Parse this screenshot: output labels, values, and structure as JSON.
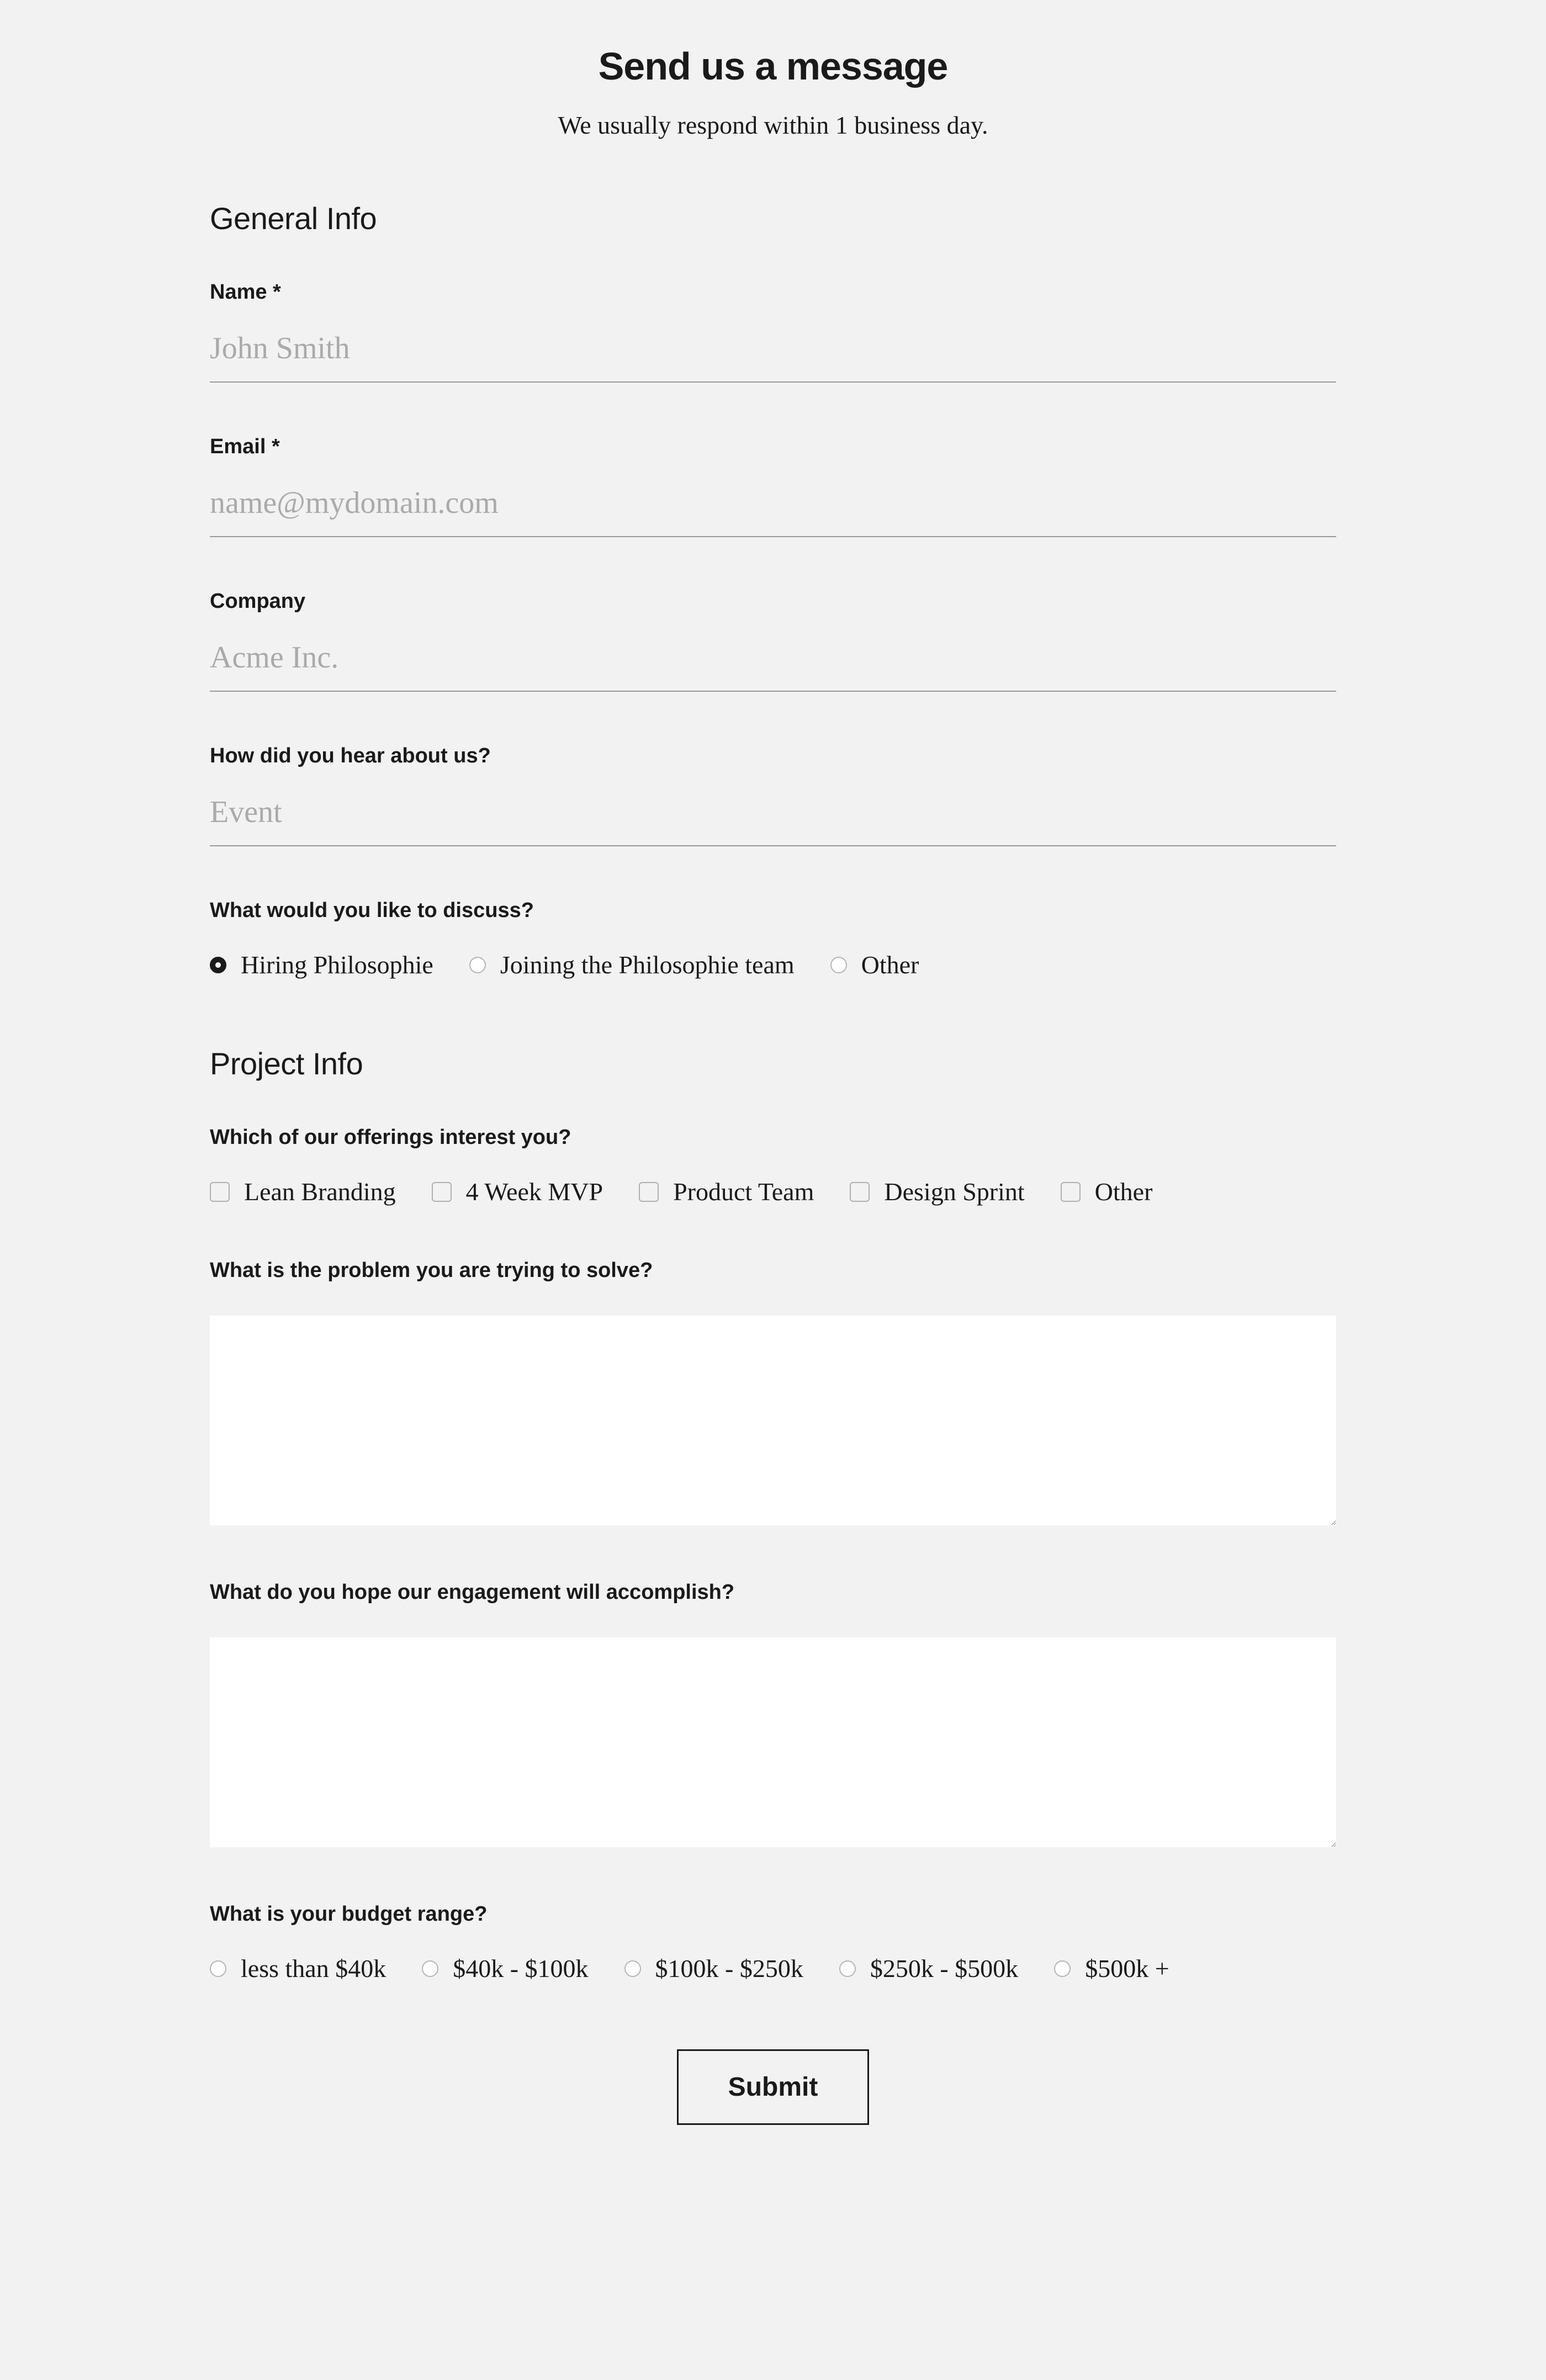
{
  "header": {
    "title": "Send us a message",
    "subtitle": "We usually respond within 1 business day."
  },
  "section_general": {
    "heading": "General Info",
    "fields": {
      "name": {
        "label": "Name *",
        "placeholder": "John Smith",
        "value": ""
      },
      "email": {
        "label": "Email *",
        "placeholder": "name@mydomain.com",
        "value": ""
      },
      "company": {
        "label": "Company",
        "placeholder": "Acme Inc.",
        "value": ""
      },
      "hear": {
        "label": "How did you hear about us?",
        "placeholder": "Event",
        "value": ""
      },
      "discuss": {
        "label": "What would you like to discuss?",
        "options": [
          "Hiring Philosophie",
          "Joining the Philosophie team",
          "Other"
        ],
        "selected": "Hiring Philosophie"
      }
    }
  },
  "section_project": {
    "heading": "Project Info",
    "fields": {
      "offerings": {
        "label": "Which of our offerings interest you?",
        "options": [
          "Lean Branding",
          "4 Week MVP",
          "Product Team",
          "Design Sprint",
          "Other"
        ]
      },
      "problem": {
        "label": "What is the problem you are trying to solve?",
        "value": ""
      },
      "engagement": {
        "label": "What do you hope our engagement will accomplish?",
        "value": ""
      },
      "budget": {
        "label": "What is your budget range?",
        "options": [
          "less than $40k",
          "$40k - $100k",
          "$100k - $250k",
          "$250k - $500k",
          "$500k +"
        ]
      }
    }
  },
  "submit": {
    "label": "Submit"
  }
}
